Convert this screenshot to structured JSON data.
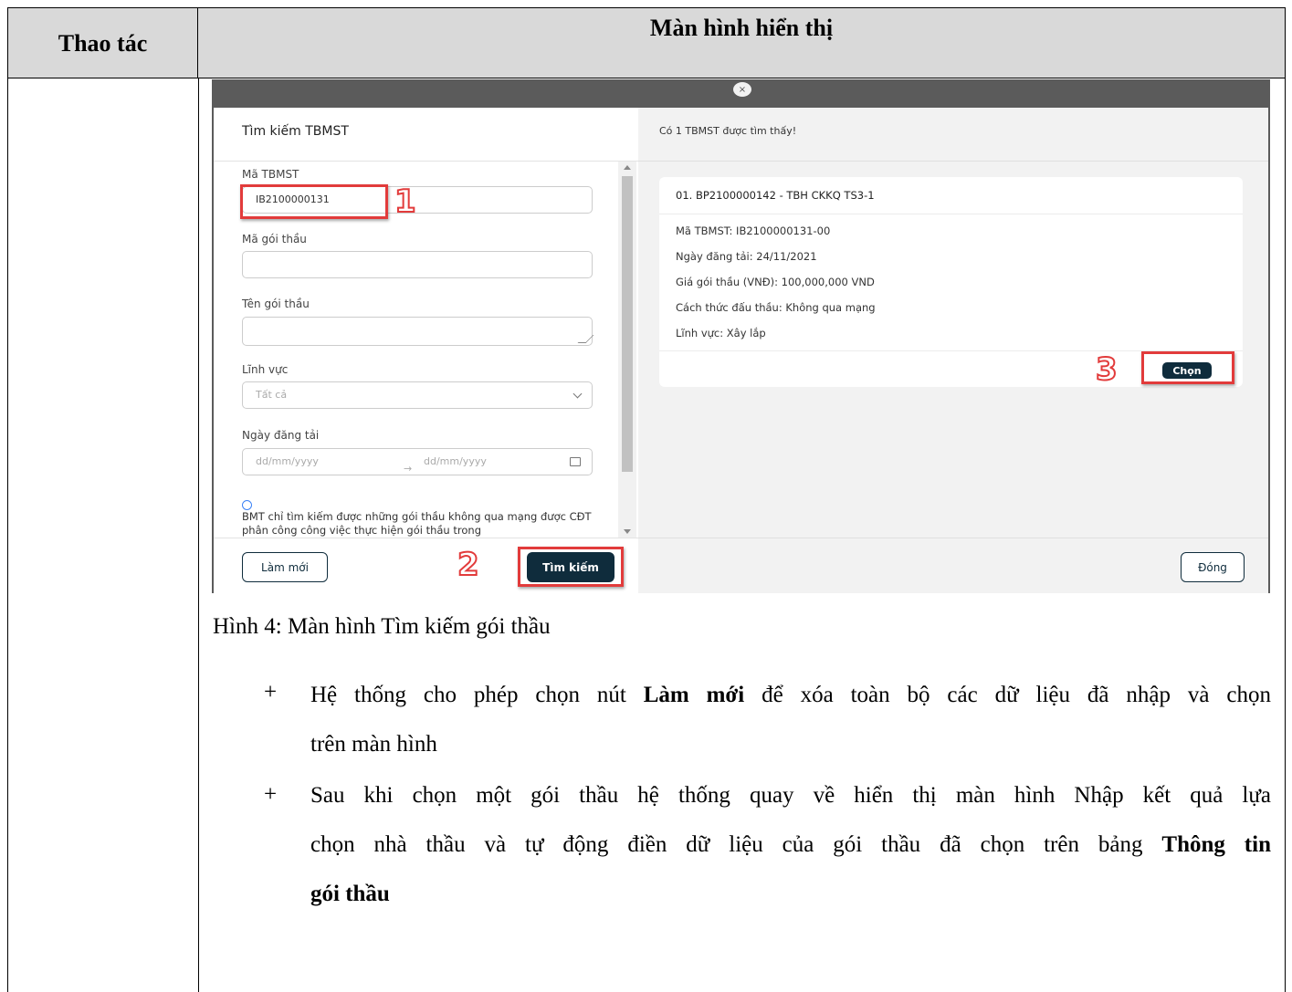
{
  "header": {
    "col1": "Thao tác",
    "col2": "Màn hình hiển thị"
  },
  "screenshot": {
    "close_glyph": "×",
    "left": {
      "title": "Tìm kiếm TBMST",
      "fields": {
        "ma_tbmst_label": "Mã TBMST",
        "ma_tbmst_value": "IB2100000131",
        "ma_goi_thau_label": "Mã gói thầu",
        "ten_goi_thau_label": "Tên gói thầu",
        "linh_vuc_label": "Lĩnh vực",
        "linh_vuc_value": "Tất cả",
        "ngay_dang_tai_label": "Ngày đăng tải",
        "date_from_placeholder": "dd/mm/yyyy",
        "date_to_placeholder": "dd/mm/yyyy"
      },
      "info_text": "BMT chỉ tìm kiếm được những gói thầu không qua mạng được CĐT phân công công việc thực hiện gói thầu trong",
      "reset_button": "Làm mới",
      "search_button": "Tìm kiếm"
    },
    "right": {
      "found_text": "Có 1 TBMST được tìm thấy!",
      "result": {
        "title": "01. BP2100000142 - TBH CKKQ TS3-1",
        "ma_tbmst": "Mã TBMST: IB2100000131-00",
        "ngay_dang_tai": "Ngày đăng tải: 24/11/2021",
        "gia_goi_thau": "Giá gói thầu (VNĐ): 100,000,000 VND",
        "cach_thuc": "Cách thức đấu thầu: Không qua mạng",
        "linh_vuc": "Lĩnh vực: Xây lắp",
        "pick_button": "Chọn"
      },
      "close_button": "Đóng"
    },
    "annotations": [
      "1",
      "2",
      "3"
    ]
  },
  "caption": "Hình 4: Màn hình Tìm kiếm gói thầu",
  "bullets": [
    {
      "marker": "+",
      "line1_pre": "Hệ thống cho phép chọn nút ",
      "line1_bold": "Làm mới",
      "line1_post": " để xóa toàn bộ các dữ liệu đã nhập và chọn",
      "line2": "trên màn hình"
    },
    {
      "marker": "+",
      "line1": "Sau khi chọn một gói thầu hệ thống quay về hiển thị màn hình Nhập kết quả lựa",
      "line2_pre": "chọn nhà thầu và tự động điền dữ liệu của gói thầu đã chọn trên bảng ",
      "line2_bold": "Thông tin",
      "line3_bold": "gói thầu"
    }
  ]
}
